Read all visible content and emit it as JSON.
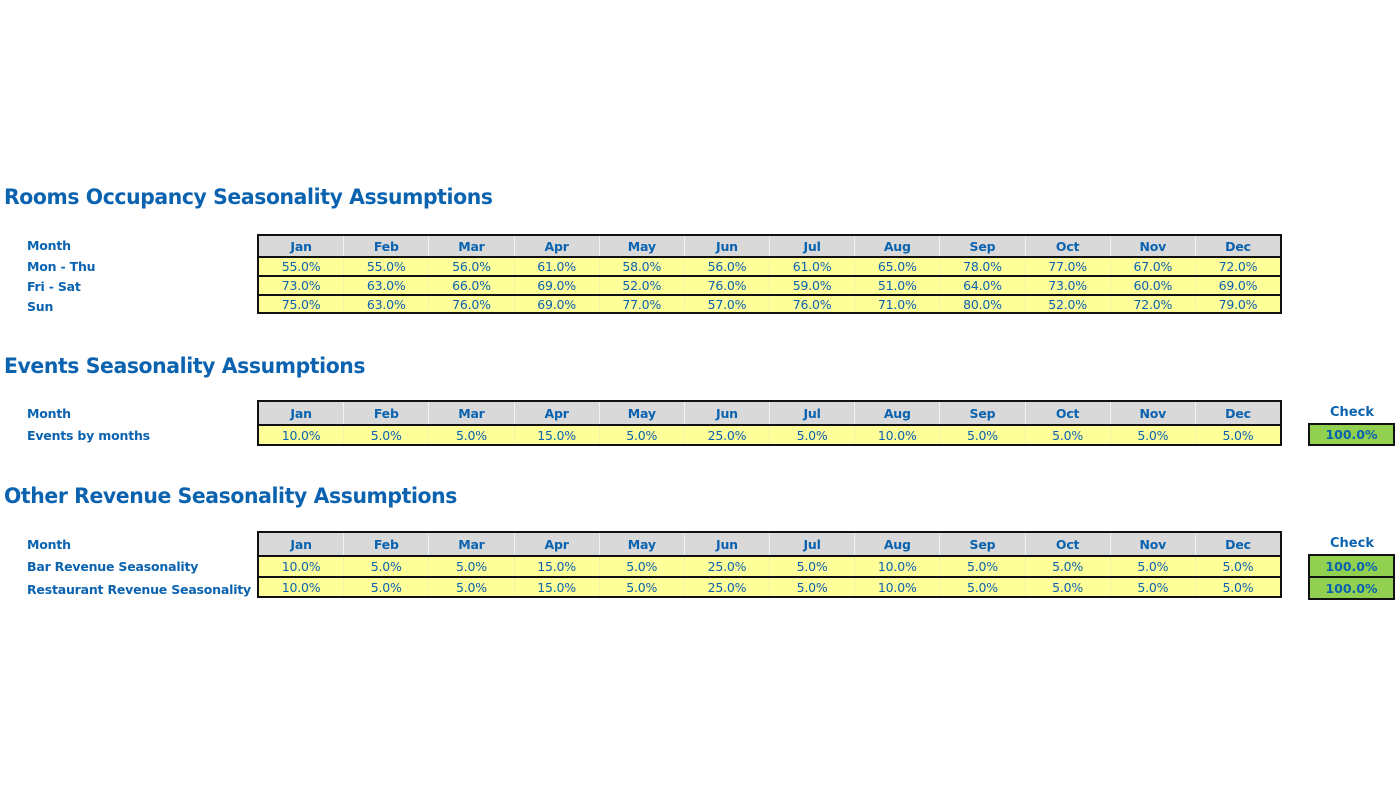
{
  "months": [
    "Jan",
    "Feb",
    "Mar",
    "Apr",
    "May",
    "Jun",
    "Jul",
    "Aug",
    "Sep",
    "Oct",
    "Nov",
    "Dec"
  ],
  "rooms": {
    "title": "Rooms Occupancy Seasonality Assumptions",
    "header_label": "Month",
    "rows": [
      {
        "label": "Mon - Thu",
        "values": [
          "55.0%",
          "55.0%",
          "56.0%",
          "61.0%",
          "58.0%",
          "56.0%",
          "61.0%",
          "65.0%",
          "78.0%",
          "77.0%",
          "67.0%",
          "72.0%"
        ]
      },
      {
        "label": "Fri - Sat",
        "values": [
          "73.0%",
          "63.0%",
          "66.0%",
          "69.0%",
          "52.0%",
          "76.0%",
          "59.0%",
          "51.0%",
          "64.0%",
          "73.0%",
          "60.0%",
          "69.0%"
        ]
      },
      {
        "label": "Sun",
        "values": [
          "75.0%",
          "63.0%",
          "76.0%",
          "69.0%",
          "77.0%",
          "57.0%",
          "76.0%",
          "71.0%",
          "80.0%",
          "52.0%",
          "72.0%",
          "79.0%"
        ]
      }
    ]
  },
  "events": {
    "title": "Events Seasonality Assumptions",
    "header_label": "Month",
    "check_label": "Check",
    "rows": [
      {
        "label": "Events by months",
        "values": [
          "10.0%",
          "5.0%",
          "5.0%",
          "15.0%",
          "5.0%",
          "25.0%",
          "5.0%",
          "10.0%",
          "5.0%",
          "5.0%",
          "5.0%",
          "5.0%"
        ],
        "check": "100.0%"
      }
    ]
  },
  "other": {
    "title": "Other Revenue Seasonality Assumptions",
    "header_label": "Month",
    "check_label": "Check",
    "rows": [
      {
        "label": "Bar Revenue Seasonality",
        "values": [
          "10.0%",
          "5.0%",
          "5.0%",
          "15.0%",
          "5.0%",
          "25.0%",
          "5.0%",
          "10.0%",
          "5.0%",
          "5.0%",
          "5.0%",
          "5.0%"
        ],
        "check": "100.0%"
      },
      {
        "label": "Restaurant Revenue Seasonality",
        "values": [
          "10.0%",
          "5.0%",
          "5.0%",
          "15.0%",
          "5.0%",
          "25.0%",
          "5.0%",
          "10.0%",
          "5.0%",
          "5.0%",
          "5.0%",
          "5.0%"
        ],
        "check": "100.0%"
      }
    ]
  },
  "colors": {
    "text_blue": "#0b63b0",
    "header_gray": "#d9d9d9",
    "input_yellow": "#ffff99",
    "check_green": "#92d050"
  }
}
